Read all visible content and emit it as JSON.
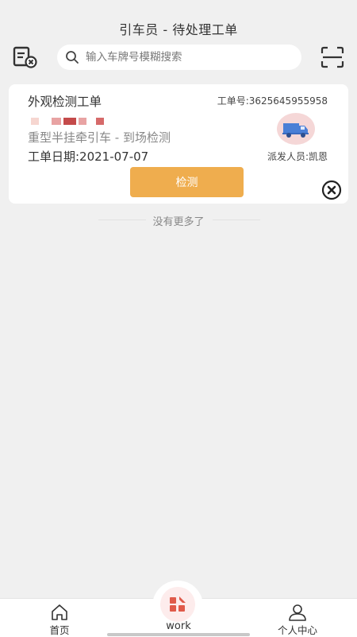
{
  "header": {
    "title": "引车员 - 待处理工单",
    "search_placeholder": "输入车牌号模糊搜索"
  },
  "order_card": {
    "title": "外观检测工单",
    "order_number": "工单号:3625645955958",
    "vehicle_description": "重型半挂牵引车 - 到场检测",
    "date": "工单日期:2021-07-07",
    "dispatcher": "派发人员:凯恩",
    "detect_button": "检测"
  },
  "list_footer": "没有更多了",
  "bottom_nav": {
    "home": "首页",
    "work": "work",
    "profile": "个人中心"
  },
  "colors": {
    "accent": "#efad4e",
    "background": "#f0f0f0",
    "truck_bg": "#f5d7d7",
    "truck_body": "#4a7fd6",
    "work_icon": "#e05a4a"
  }
}
